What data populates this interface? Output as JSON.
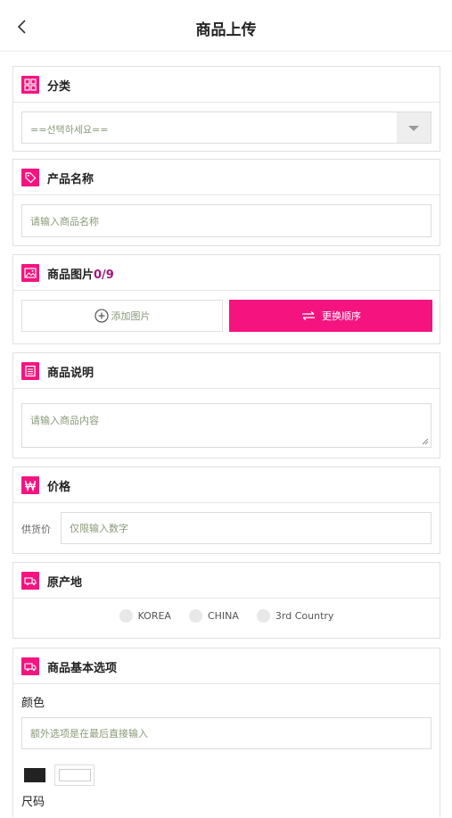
{
  "header": {
    "title": "商品上传"
  },
  "category": {
    "title": "分类",
    "select_value": "==선택하세요=="
  },
  "product_name": {
    "title": "产品名称",
    "placeholder": "请输入商品名称"
  },
  "product_images": {
    "title": "商品图片",
    "count": "0/9",
    "add_label": "添加图片",
    "reorder_label": "更换顺序"
  },
  "description": {
    "title": "商品说明",
    "placeholder": "请输入商品内容"
  },
  "price": {
    "title": "价格",
    "supply_label": "供货价",
    "placeholder": "仅限输入数字"
  },
  "origin": {
    "title": "原产地",
    "options": [
      "KOREA",
      "CHINA",
      "3rd Country"
    ]
  },
  "basic_options": {
    "title": "商品基本选项",
    "color_label": "颜色",
    "color_placeholder": "额外选项是在最后直接输入",
    "swatch_colors": [
      "#222222",
      "#ffffff"
    ],
    "size_label": "尺码"
  },
  "colors": {
    "accent": "#f5147f",
    "count_color": "#a3157a"
  },
  "icons": [
    "chevron-left-icon",
    "grid-icon",
    "tag-icon",
    "image-icon",
    "document-icon",
    "won-icon",
    "truck-icon",
    "plus-circle-icon",
    "swap-arrows-icon"
  ]
}
